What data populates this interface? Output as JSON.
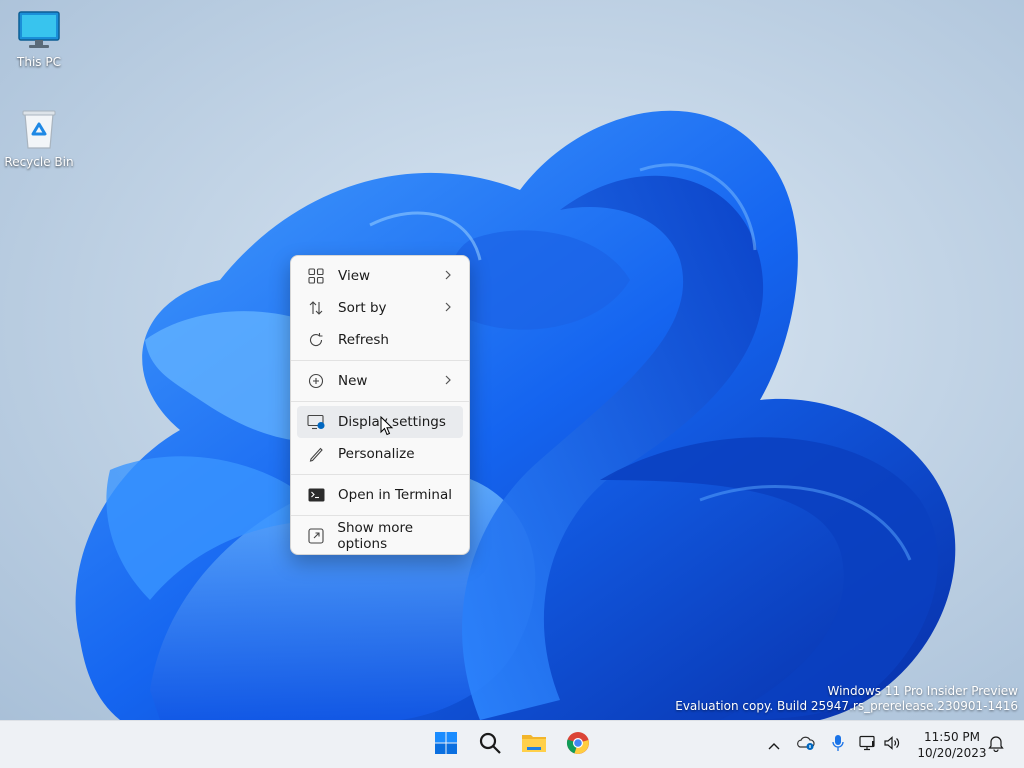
{
  "desktop": {
    "icons": [
      {
        "label": "This PC",
        "icon": "monitor-icon"
      },
      {
        "label": "Recycle Bin",
        "icon": "recycle-bin-icon"
      }
    ],
    "watermark": {
      "line1": "Windows 11 Pro Insider Preview",
      "line2": "Evaluation copy. Build 25947.rs_prerelease.230901-1416"
    }
  },
  "context_menu": {
    "items": [
      {
        "label": "View",
        "icon": "grid-icon",
        "submenu": true
      },
      {
        "label": "Sort by",
        "icon": "sort-icon",
        "submenu": true
      },
      {
        "label": "Refresh",
        "icon": "refresh-icon",
        "submenu": false
      },
      {
        "label": "New",
        "icon": "plus-circle-icon",
        "submenu": true
      },
      {
        "label": "Display settings",
        "icon": "display-icon",
        "submenu": false,
        "hovered": true
      },
      {
        "label": "Personalize",
        "icon": "pen-icon",
        "submenu": false
      },
      {
        "label": "Open in Terminal",
        "icon": "terminal-icon",
        "submenu": false
      },
      {
        "label": "Show more options",
        "icon": "expand-icon",
        "submenu": false
      }
    ]
  },
  "taskbar": {
    "apps": [
      "windows-start-icon",
      "search-icon",
      "file-explorer-icon",
      "chrome-icon"
    ],
    "tray": [
      "chevron-up-icon",
      "onedrive-icon",
      "microphone-icon",
      "network-icon",
      "volume-icon"
    ],
    "clock": {
      "time": "11:50 PM",
      "date": "10/20/2023"
    }
  },
  "colors": {
    "accent": "#0067c0",
    "bloom_dark": "#0a3fbf",
    "bloom_light": "#3d97ff",
    "menu_bg": "#f9f9f9",
    "taskbar_bg": "#eef1f5"
  }
}
